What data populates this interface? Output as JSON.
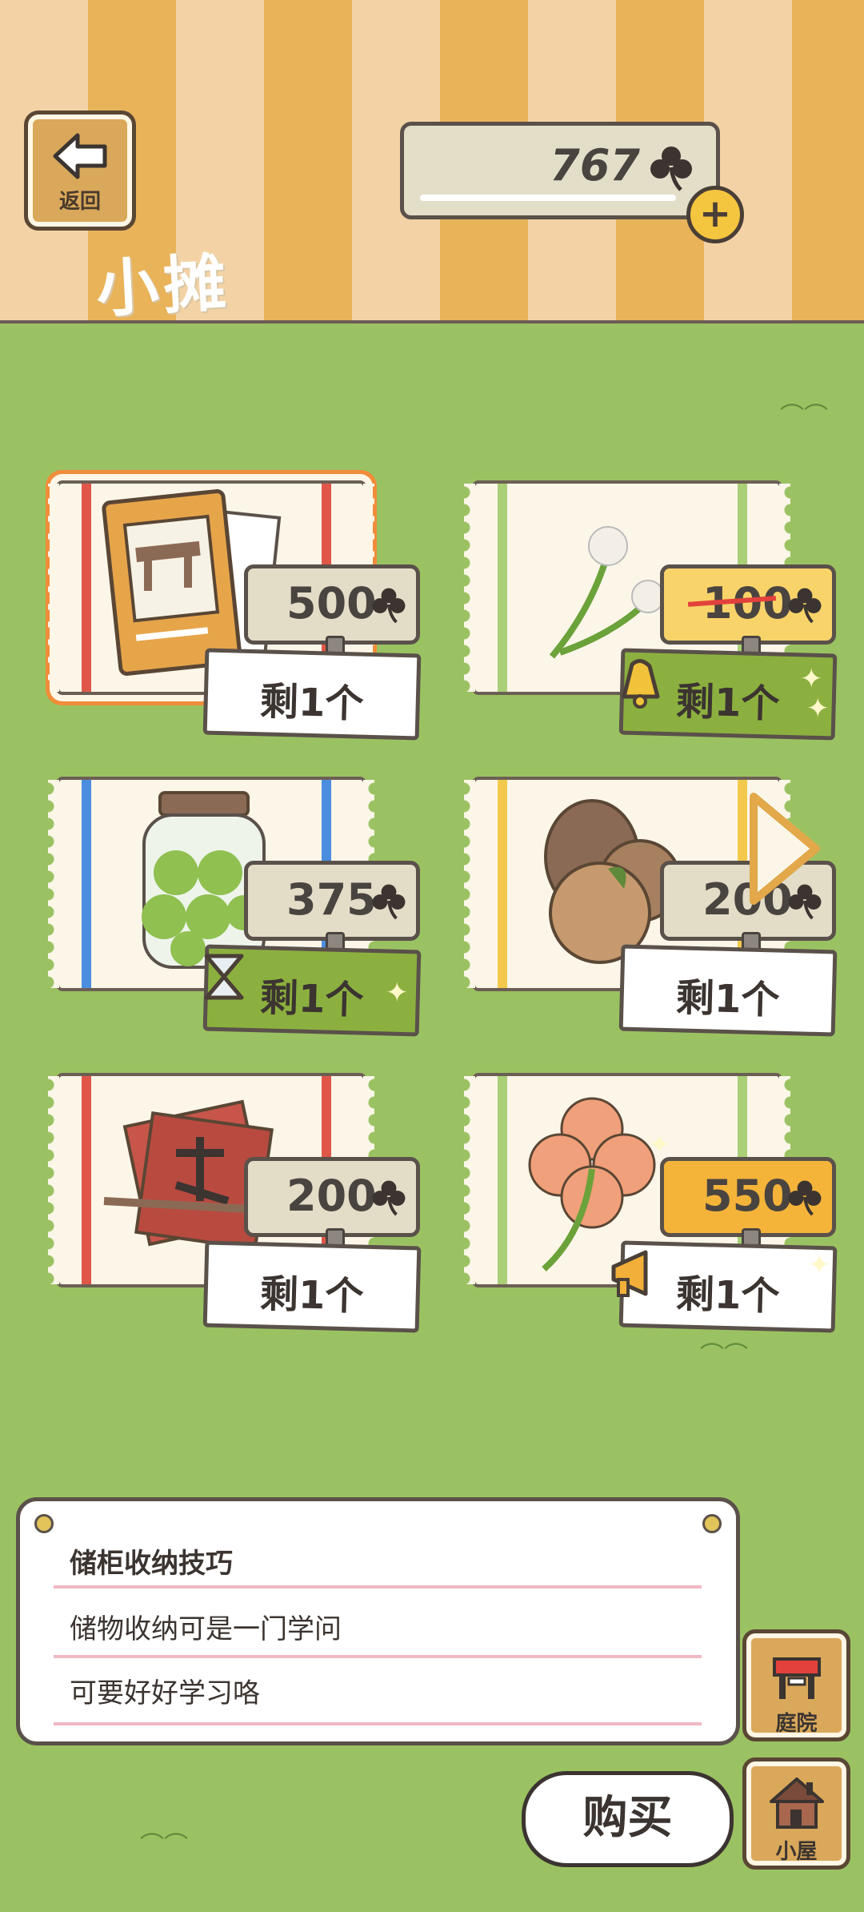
{
  "header": {
    "back_label": "返回",
    "title": "小摊",
    "currency_value": "767",
    "currency_icon": "clover-icon",
    "add_icon": "plus-icon"
  },
  "items": [
    {
      "name": "storage-book",
      "price": "500",
      "stock": "剩1个",
      "selected": true
    },
    {
      "name": "dandelions",
      "price": "100",
      "stock": "剩1个",
      "on_sale": true
    },
    {
      "name": "pickle-jar",
      "price": "375",
      "stock": "剩1个",
      "timed": true
    },
    {
      "name": "pinecone-chestnut",
      "price": "200",
      "stock": "剩1个"
    },
    {
      "name": "calligraphy-paper",
      "price": "200",
      "stock": "剩1个"
    },
    {
      "name": "four-leaf-clover",
      "price": "550",
      "stock": "剩1个",
      "special": true
    }
  ],
  "info": {
    "title": "储柜收纳技巧",
    "line1": "储物收纳可是一门学问",
    "line2": "可要好好学习咯"
  },
  "buttons": {
    "buy": "购买",
    "yard": "庭院",
    "house": "小屋"
  },
  "colors": {
    "grass": "#9bc262",
    "stripe_light": "#f3d3a6",
    "stripe_dark": "#e9b35a",
    "wood": "#d9a85a",
    "selected_border": "#f08c3a",
    "sale_strike": "#e2413c"
  }
}
